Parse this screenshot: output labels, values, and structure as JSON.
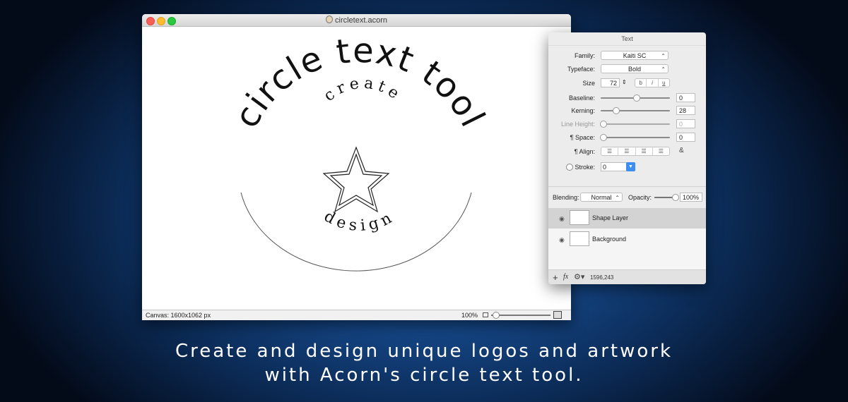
{
  "window": {
    "title": "circletext.acorn",
    "status_canvas": "Canvas: 1600x1062 px",
    "zoom": "100%"
  },
  "artwork": {
    "outer_text": "circle text tool",
    "top_small_text": "create",
    "bottom_small_text": "design"
  },
  "text_panel": {
    "title": "Text",
    "family_label": "Family:",
    "family_value": "Kaiti SC",
    "typeface_label": "Typeface:",
    "typeface_value": "Bold",
    "size_label": "Size",
    "size_value": "72",
    "style_buttons": [
      "b",
      "i",
      "u"
    ],
    "baseline_label": "Baseline:",
    "baseline_value": "0",
    "kerning_label": "Kerning:",
    "kerning_value": "28",
    "line_height_label": "Line Height:",
    "line_height_value": "0",
    "space_label": "¶ Space:",
    "space_value": "0",
    "align_label": "¶ Align:",
    "stroke_label": "Stroke:",
    "stroke_value": "0",
    "blending_label": "Blending:",
    "blending_value": "Normal",
    "opacity_label": "Opacity:",
    "opacity_value": "100%"
  },
  "layers": [
    {
      "name": "Shape Layer",
      "selected": true
    },
    {
      "name": "Background",
      "selected": false
    }
  ],
  "panel_footer": {
    "coords": "1596,243"
  },
  "caption": {
    "line1": "Create and design unique logos and artwork",
    "line2": "with Acorn's circle text tool."
  }
}
